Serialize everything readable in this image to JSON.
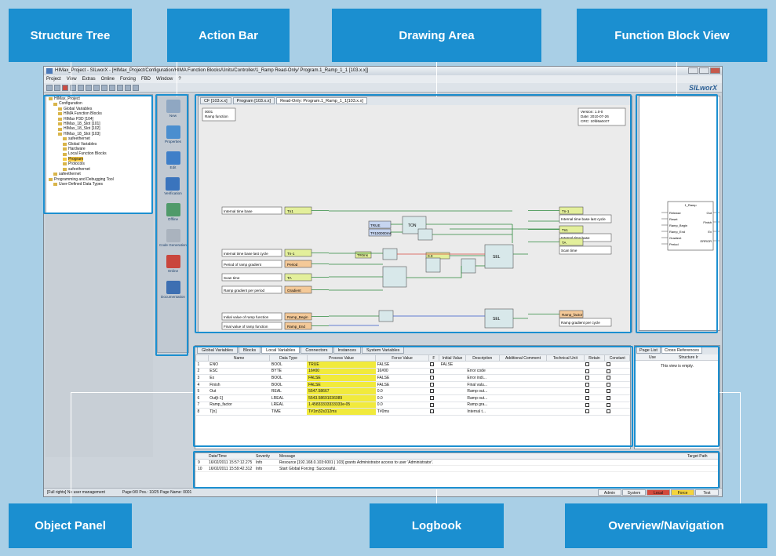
{
  "callouts": {
    "structure_tree": "Structure Tree",
    "action_bar": "Action Bar",
    "drawing_area": "Drawing Area",
    "function_block_view": "Function Block View",
    "object_panel": "Object Panel",
    "logbook": "Logbook",
    "overview_navigation": "Overview/Navigation"
  },
  "colors": {
    "accent": "#1b8fd0",
    "background": "#a9cfe6",
    "highlight": "#f1ea3c"
  },
  "window": {
    "title": "HIMax_Project - SILworX - [HIMax_Project/Configuration/HIMA Function Blocks/Units/Controller/1_Ramp Read-Only/ Program.1_Ramp_1_1 [103.x.x]]",
    "logo": "SILworX"
  },
  "menu": [
    "Project",
    "View",
    "Extras",
    "Online",
    "Forcing",
    "FBD",
    "Window",
    "?"
  ],
  "tree": [
    {
      "label": "HIMax_Project",
      "depth": 0
    },
    {
      "label": "Configuration",
      "depth": 1
    },
    {
      "label": "Global Variables",
      "depth": 2
    },
    {
      "label": "HIMA Function Blocks",
      "depth": 2
    },
    {
      "label": "HIMax P3D [104]",
      "depth": 2
    },
    {
      "label": "HIMax_18_Slot [101]",
      "depth": 2
    },
    {
      "label": "HIMax_18_Slot [102]",
      "depth": 2
    },
    {
      "label": "HIMax_18_Slot [103]",
      "depth": 2
    },
    {
      "label": "safeethernet",
      "depth": 3
    },
    {
      "label": "Global Variables",
      "depth": 3
    },
    {
      "label": "Hardware",
      "depth": 3
    },
    {
      "label": "Local Function Blocks",
      "depth": 3
    },
    {
      "label": "Program",
      "depth": 3,
      "selected": true
    },
    {
      "label": "Protocols",
      "depth": 3
    },
    {
      "label": "safeethernet",
      "depth": 3
    },
    {
      "label": "safeethernet",
      "depth": 1
    },
    {
      "label": "Programming and Debugging Tool",
      "depth": 0
    },
    {
      "label": "User-Defined Data Types",
      "depth": 1
    }
  ],
  "actions": [
    {
      "label": "New",
      "color": "#8fa7c2"
    },
    {
      "label": "Properties",
      "color": "#4a8ecf"
    },
    {
      "label": "Edit",
      "color": "#3f7fc8"
    },
    {
      "label": "Verification",
      "color": "#3a74bd"
    },
    {
      "label": "Offline",
      "color": "#4f9a6a"
    },
    {
      "label": "Code Generation",
      "color": "#aab3be"
    },
    {
      "label": "Online",
      "color": "#c9463d"
    },
    {
      "label": "Documentation",
      "color": "#3d6fb2"
    }
  ],
  "drawing": {
    "tabs": [
      "CF [103.x.x]",
      "Program [103.x.x]",
      "Read-Only: Program.1_Ramp_1_1[103.x.x]"
    ],
    "comment_lines": [
      "0001",
      "Ramp function"
    ],
    "version_lines": [
      "Version: 1.0-0",
      "Date: 2010-07-26",
      "CRC: 10fd6a0c07"
    ],
    "in_labels": [
      "Internal time base",
      "Internal time base last cycle",
      "Period of ramp gradient",
      "Scan time",
      "Ramp gradient per period",
      "Initial value of ramp function",
      "Final value of ramp function"
    ],
    "in_vars": [
      "Tn1",
      "Tn-1",
      "Period",
      "TA",
      "Gradient",
      "Ramp_Begin",
      "Ramp_End"
    ],
    "out_vars": [
      "Tn-1",
      "Tn1",
      "TA",
      "Ramp_factor"
    ],
    "out_labels": [
      "Internal time base last cycle",
      "Internal time base",
      "Scan time",
      "Ramp gradient per cycle"
    ],
    "constants": [
      "TRUE",
      "T#100000ms",
      "T#0ms",
      "0.0"
    ],
    "blocks": [
      "TON",
      "SEL",
      "SEL"
    ]
  },
  "fb_view": {
    "name": "1_Ramp",
    "inputs": [
      "Release",
      "Reset",
      "Ramp_Begin",
      "Ramp_End",
      "Gradient",
      "Period"
    ],
    "outputs": [
      "Out",
      "Finish",
      "Ex",
      "ERROR"
    ]
  },
  "object_panel": {
    "tabs": [
      "Global Variables",
      "Blocks",
      "Local Variables",
      "Connectors",
      "Instances",
      "System Variables"
    ],
    "active_tab": 2,
    "columns": [
      "",
      "Name",
      "Data Type",
      "Process Value",
      "Force Value",
      "F",
      "Initial Value",
      "Description",
      "Additional Comment",
      "Technical Unit",
      "Retain",
      "Constant"
    ],
    "rows": [
      [
        "1",
        "ENO",
        "BOOL",
        "TRUE",
        "FALSE",
        "FALSE",
        ""
      ],
      [
        "2",
        "ESC",
        "BYTE",
        "16#00",
        "16#00",
        "",
        "Error code"
      ],
      [
        "3",
        "Ex",
        "BOOL",
        "FALSE",
        "FALSE",
        "",
        "Error indi..."
      ],
      [
        "4",
        "Finish",
        "BOOL",
        "FALSE",
        "FALSE",
        "",
        "Final valu..."
      ],
      [
        "5",
        "Out",
        "REAL",
        "5547.58667",
        "0.0",
        "",
        "Ramp out..."
      ],
      [
        "6",
        "Out[t-1]",
        "LREAL",
        "5543.58691036089",
        "0.0",
        "",
        "Ramp out..."
      ],
      [
        "7",
        "Ramp_factor",
        "LREAL",
        "1.45833333333333e-05",
        "0.0",
        "",
        "Ramp gra..."
      ],
      [
        "8",
        "T[n]",
        "TIME",
        "T#1m32s312ms",
        "T#0ms",
        "",
        "Internal t..."
      ]
    ]
  },
  "nav_panel": {
    "tabs": [
      "Page List",
      "Cross References"
    ],
    "columns": [
      "Use",
      "Structure Ir"
    ],
    "empty_text": "This view is empty."
  },
  "logbook": {
    "columns": [
      "",
      "Date/Time",
      "Severity",
      "Message",
      "Target Path"
    ],
    "rows": [
      [
        "9",
        "16/02/2011 15:57:12.275",
        "Info",
        "Resource [192.168.0.103:6001 | 103] grants Administrator access to user 'Administrator'."
      ],
      [
        "10",
        "16/02/2011 15:59:42.312",
        "Info",
        "Start Global Forcing: Successful."
      ]
    ]
  },
  "status": {
    "left": "[Full rights] No user management",
    "mid": "Page:0/0 Pos.: 10/25 Page Name: 0001",
    "right": [
      "Admin",
      "System",
      "Local",
      "Force",
      "Test"
    ]
  }
}
